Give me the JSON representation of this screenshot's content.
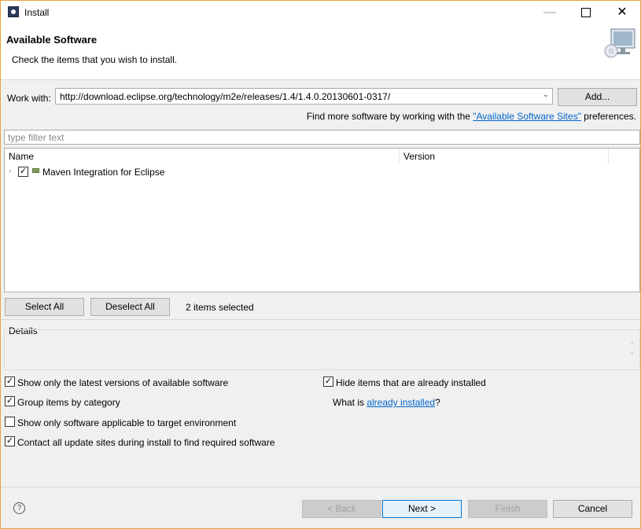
{
  "window": {
    "title": "Install"
  },
  "header": {
    "title": "Available Software",
    "description": "Check the items that you wish to install."
  },
  "work_with": {
    "label": "Work with:",
    "value": "http://download.eclipse.org/technology/m2e/releases/1.4/1.4.0.20130601-0317/",
    "add_label": "Add..."
  },
  "find_more": {
    "prefix": "Find more software by working with the ",
    "link": "\"Available Software Sites\"",
    "suffix": " preferences."
  },
  "filter": {
    "placeholder": "type filter text"
  },
  "tree": {
    "columns": [
      "Name",
      "Version"
    ],
    "items": [
      {
        "label": "Maven Integration for Eclipse",
        "checked": true
      }
    ]
  },
  "selection": {
    "select_all": "Select All",
    "deselect_all": "Deselect All",
    "count": "2 items selected"
  },
  "details": {
    "label": "Details"
  },
  "options": {
    "show_latest": "Show only the latest versions of available software",
    "group_by_category": "Group items by category",
    "show_applicable": "Show only software applicable to target environment",
    "contact_sites": "Contact all update sites during install to find required software",
    "hide_installed": "Hide items that are already installed",
    "what_is_prefix": "What is ",
    "what_is_link": "already installed",
    "what_is_suffix": "?"
  },
  "buttons": {
    "back": "< Back",
    "next": "Next >",
    "finish": "Finish",
    "cancel": "Cancel"
  }
}
